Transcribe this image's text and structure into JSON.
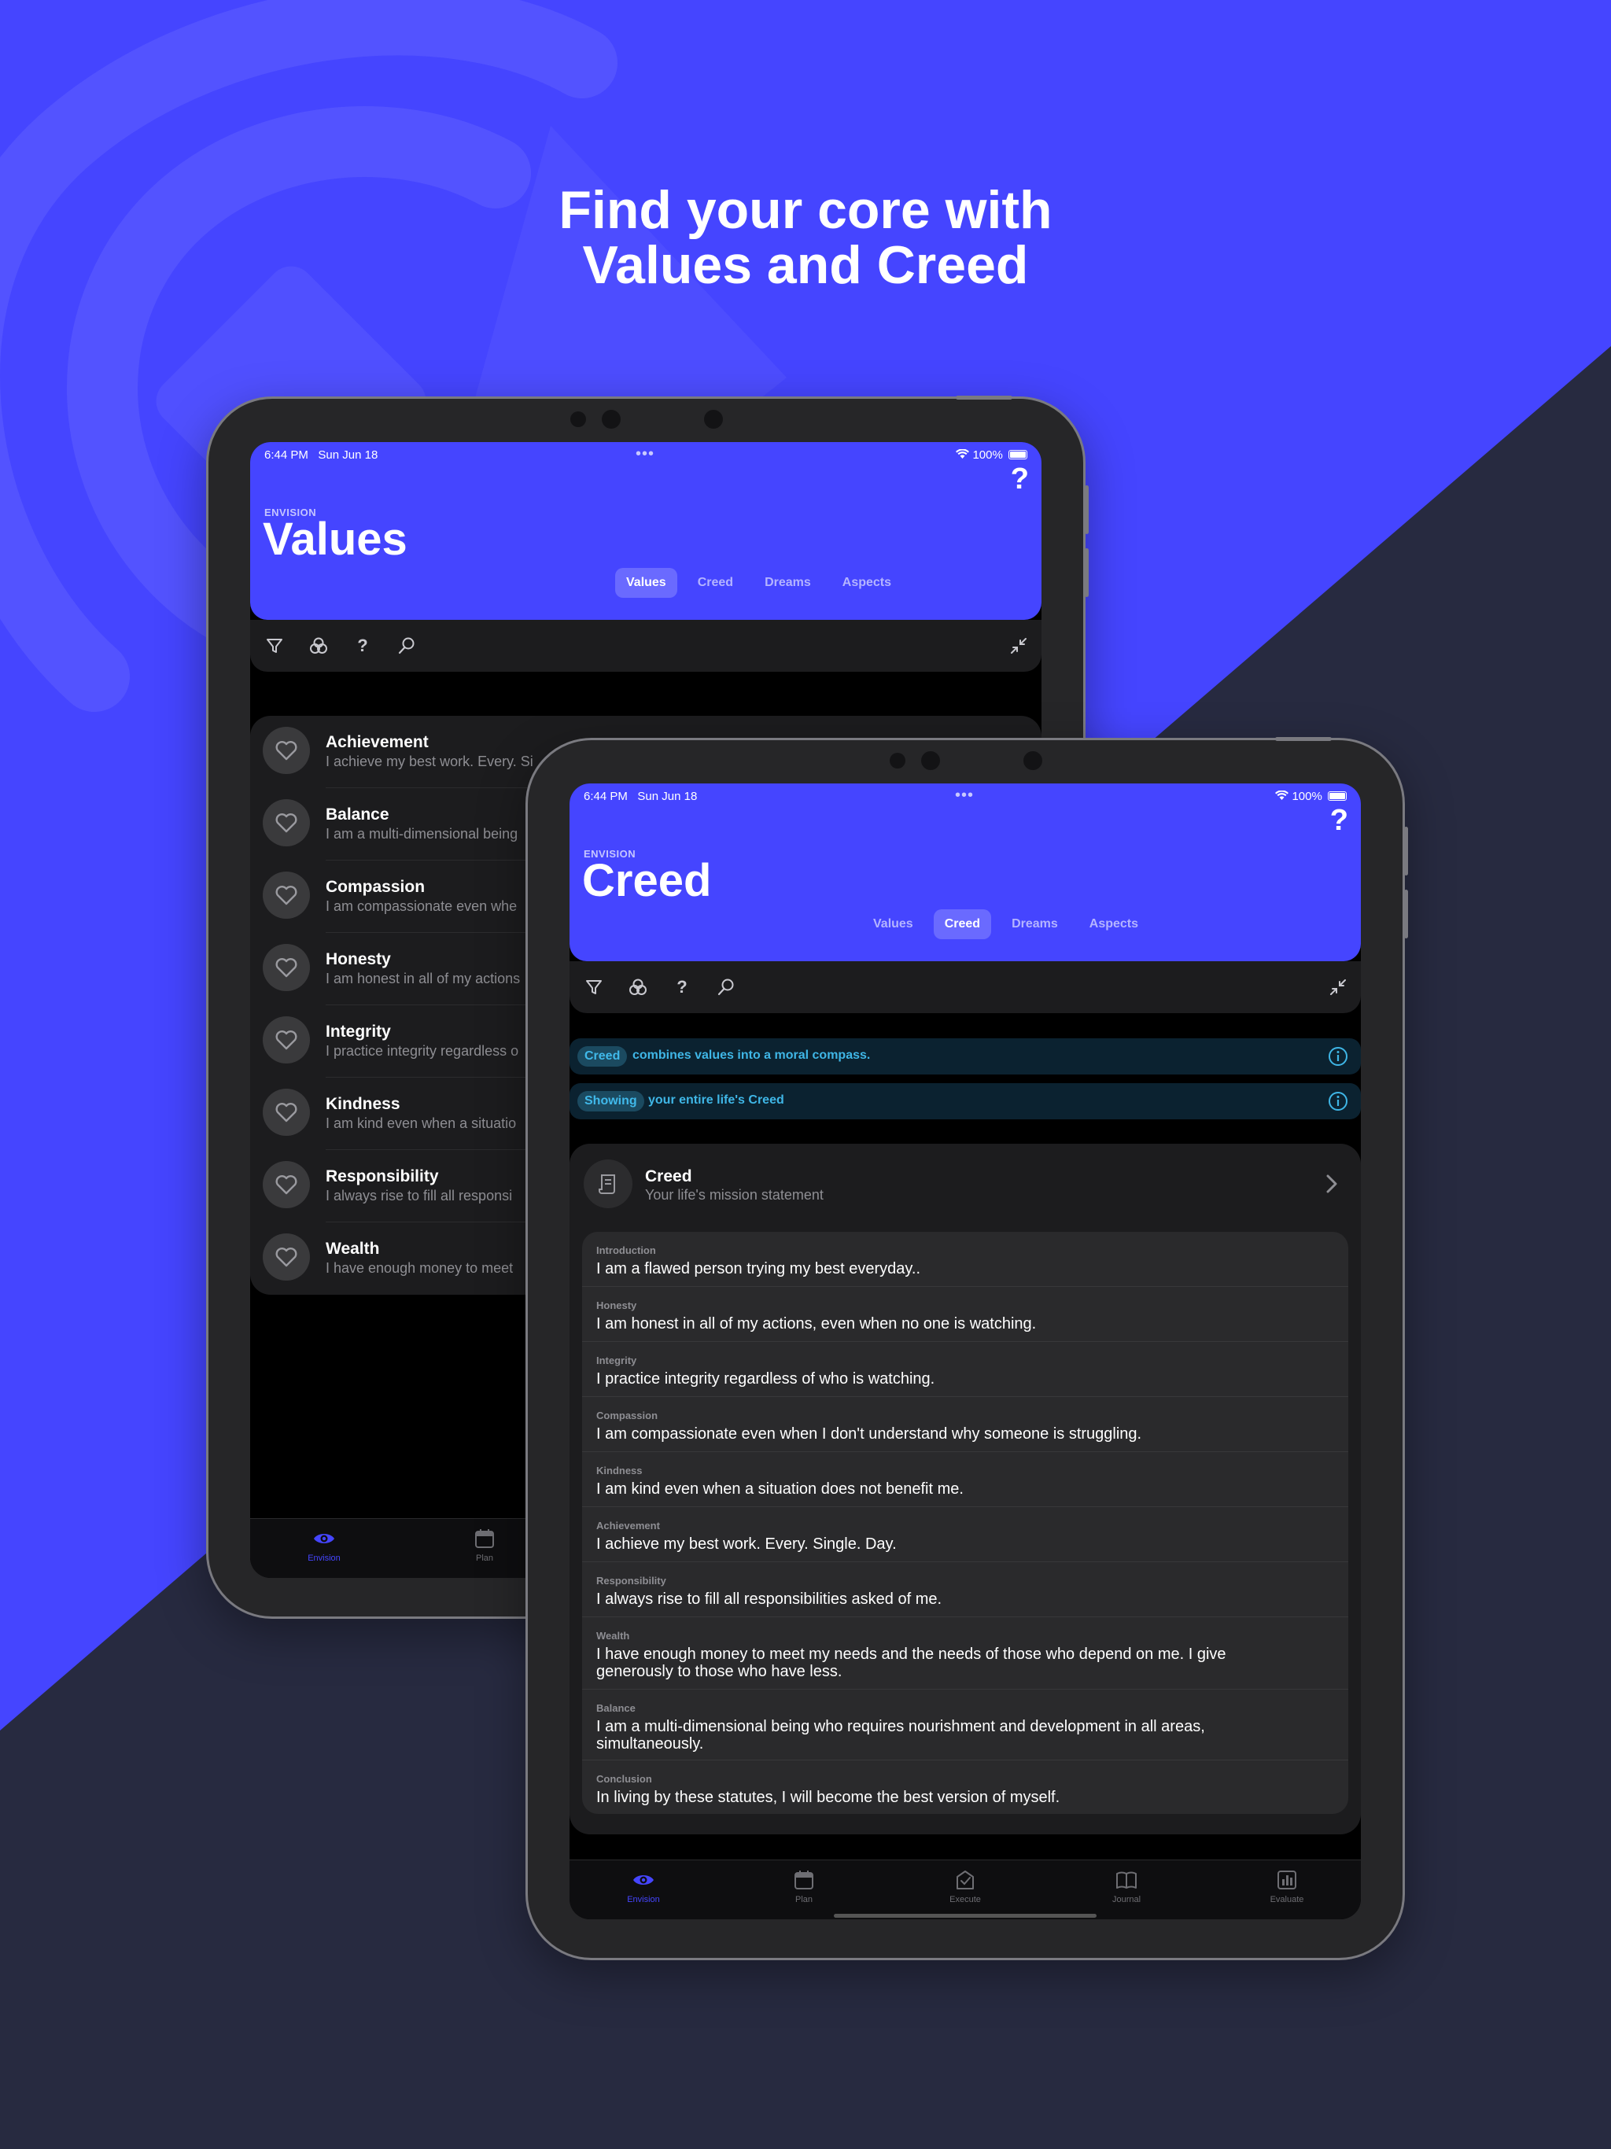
{
  "headline": {
    "line1": "Find your core with",
    "line2": "Values and Creed"
  },
  "colors": {
    "accent": "#4545ff",
    "background_top": "#4545ff",
    "background_bottom": "#272a40",
    "info": "#3fb6e6"
  },
  "values_screen": {
    "status": {
      "time": "6:44 PM",
      "date": "Sun Jun 18",
      "battery": "100%"
    },
    "section": "ENVISION",
    "title": "Values",
    "help": "?",
    "tabs": [
      {
        "label": "Values",
        "active": true
      },
      {
        "label": "Creed",
        "active": false
      },
      {
        "label": "Dreams",
        "active": false
      },
      {
        "label": "Aspects",
        "active": false
      }
    ],
    "toolbar": [
      "filter-icon",
      "aspects-icon",
      "help-icon",
      "search-icon",
      "collapse-icon"
    ],
    "items": [
      {
        "title": "Achievement",
        "subtitle": "I achieve my best work. Every. Si"
      },
      {
        "title": "Balance",
        "subtitle": "I am a multi-dimensional being"
      },
      {
        "title": "Compassion",
        "subtitle": "I am compassionate even whe"
      },
      {
        "title": "Honesty",
        "subtitle": "I am honest in all of my actions"
      },
      {
        "title": "Integrity",
        "subtitle": "I practice integrity regardless o"
      },
      {
        "title": "Kindness",
        "subtitle": "I am kind even when a situatio"
      },
      {
        "title": "Responsibility",
        "subtitle": "I always rise to fill all responsi"
      },
      {
        "title": "Wealth",
        "subtitle": "I have enough money to meet"
      }
    ],
    "tabbar": [
      {
        "label": "Envision",
        "icon": "eye-icon",
        "active": true
      },
      {
        "label": "Plan",
        "icon": "calendar-icon",
        "active": false
      }
    ]
  },
  "creed_screen": {
    "status": {
      "time": "6:44 PM",
      "date": "Sun Jun 18",
      "battery": "100%"
    },
    "section": "ENVISION",
    "title": "Creed",
    "help": "?",
    "tabs": [
      {
        "label": "Values",
        "active": false
      },
      {
        "label": "Creed",
        "active": true
      },
      {
        "label": "Dreams",
        "active": false
      },
      {
        "label": "Aspects",
        "active": false
      }
    ],
    "banners": [
      {
        "pill": "Creed",
        "text": "combines values into a moral compass."
      },
      {
        "pill": "Showing",
        "text": "your entire life's Creed"
      }
    ],
    "card": {
      "title": "Creed",
      "subtitle": "Your life's mission statement"
    },
    "statements": [
      {
        "label": "Introduction",
        "text": "I am a flawed person trying my best everyday.."
      },
      {
        "label": "Honesty",
        "text": "I am honest in all of my actions, even when no one is watching."
      },
      {
        "label": "Integrity",
        "text": "I practice integrity regardless of who is watching."
      },
      {
        "label": "Compassion",
        "text": "I am compassionate even when I don't understand why someone is struggling."
      },
      {
        "label": "Kindness",
        "text": "I am kind even when a situation does not benefit me."
      },
      {
        "label": "Achievement",
        "text": "I achieve my best work. Every. Single. Day."
      },
      {
        "label": "Responsibility",
        "text": "I always rise to fill all responsibilities asked of me."
      },
      {
        "label": "Wealth",
        "text": "I have enough money to meet my needs and the needs of those who depend on me. I give generously to those who have less."
      },
      {
        "label": "Balance",
        "text": "I am a multi-dimensional being who requires nourishment and development in all areas, simultaneously."
      },
      {
        "label": "Conclusion",
        "text": "In living by these statutes, I will become the best version of myself."
      }
    ],
    "tabbar": [
      {
        "label": "Envision",
        "icon": "eye-icon",
        "active": true
      },
      {
        "label": "Plan",
        "icon": "calendar-icon",
        "active": false
      },
      {
        "label": "Execute",
        "icon": "execute-icon",
        "active": false
      },
      {
        "label": "Journal",
        "icon": "book-icon",
        "active": false
      },
      {
        "label": "Evaluate",
        "icon": "chart-icon",
        "active": false
      }
    ]
  }
}
